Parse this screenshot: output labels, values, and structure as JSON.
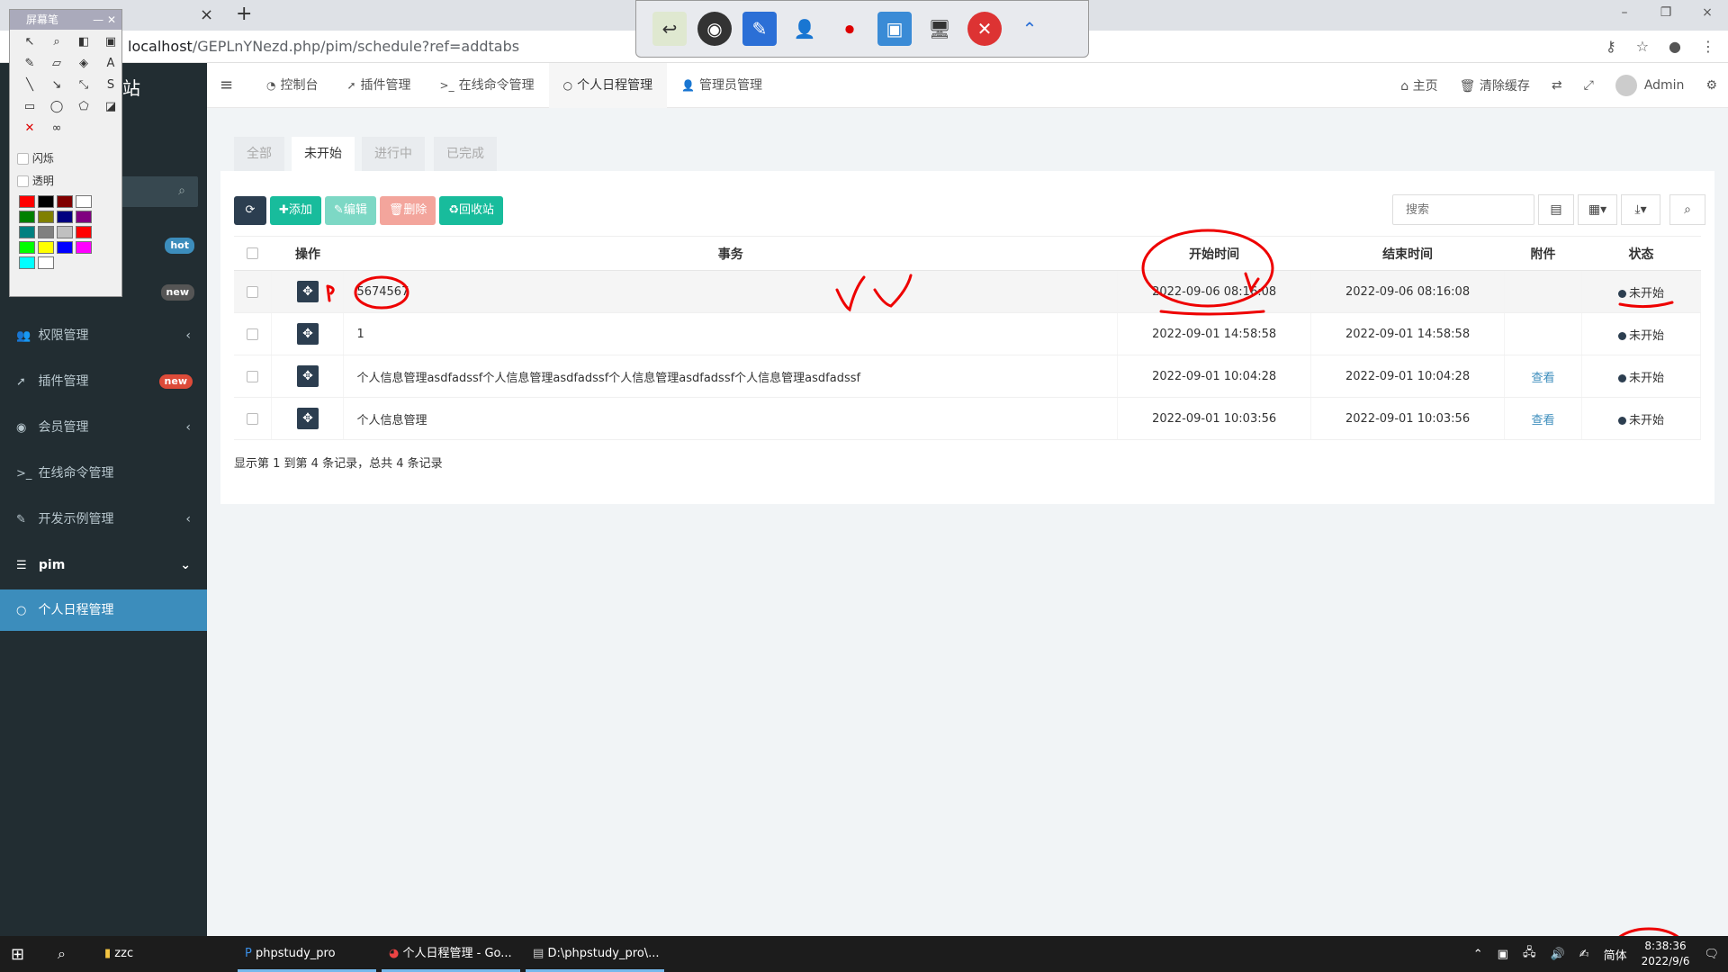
{
  "browser": {
    "close_glyph": "×",
    "new_tab_glyph": "+",
    "url_host": "localhost",
    "url_path": "/GEPLnYNezd.php/pim/schedule?ref=addtabs",
    "window_controls": [
      "–",
      "❐",
      "×"
    ]
  },
  "pen_tool": {
    "title": "屏幕笔",
    "option_flash": "闪烁",
    "option_transparent": "透明",
    "palette": [
      "#ff0000",
      "#000000",
      "#800000",
      "#ffffff",
      "#008000",
      "#808000",
      "#000080",
      "#800080",
      "#008080",
      "#808080",
      "#c0c0c0",
      "#ff0000",
      "#00ff00",
      "#ffff00",
      "#0000ff",
      "#ff00ff",
      "#00ffff",
      "#ffffff"
    ]
  },
  "sidebar": {
    "logo_suffix": "站",
    "badges": {
      "hot": "hot",
      "new": "new"
    },
    "items": [
      {
        "label": "权限管理",
        "icon": "group-icon",
        "arrow": "‹"
      },
      {
        "label": "插件管理",
        "icon": "rocket-icon",
        "badge": "new"
      },
      {
        "label": "会员管理",
        "icon": "user-circle-icon",
        "arrow": "‹"
      },
      {
        "label": "在线命令管理",
        "icon": "terminal-icon"
      },
      {
        "label": "开发示例管理",
        "icon": "magic-icon",
        "arrow": "‹"
      },
      {
        "label": "pim",
        "icon": "list-icon",
        "arrow": "⌄"
      },
      {
        "label": "个人日程管理",
        "icon": "circle-icon"
      }
    ]
  },
  "topnav": {
    "tabs": [
      {
        "label": "控制台",
        "icon": "dashboard-icon"
      },
      {
        "label": "插件管理",
        "icon": "rocket-icon"
      },
      {
        "label": "在线命令管理",
        "icon": "terminal-icon"
      },
      {
        "label": "个人日程管理",
        "icon": "circle-icon"
      },
      {
        "label": "管理员管理",
        "icon": "user-icon"
      }
    ],
    "home": "主页",
    "clear_cache": "清除缓存",
    "user": "Admin"
  },
  "subtabs": [
    "全部",
    "未开始",
    "进行中",
    "已完成"
  ],
  "toolbar": {
    "add": "添加",
    "edit": "编辑",
    "delete": "删除",
    "recycle": "回收站",
    "search_placeholder": "搜索"
  },
  "table": {
    "headers": [
      "操作",
      "事务",
      "开始时间",
      "结束时间",
      "附件",
      "状态"
    ],
    "rows": [
      {
        "task": "5674567",
        "start": "2022-09-06 08:16:08",
        "end": "2022-09-06 08:16:08",
        "attachment": "",
        "status": "未开始"
      },
      {
        "task": "1",
        "start": "2022-09-01 14:58:58",
        "end": "2022-09-01 14:58:58",
        "attachment": "",
        "status": "未开始"
      },
      {
        "task": "个人信息管理asdfadssf个人信息管理asdfadssf个人信息管理asdfadssf个人信息管理asdfadssf",
        "start": "2022-09-01 10:04:28",
        "end": "2022-09-01 10:04:28",
        "attachment": "查看",
        "status": "未开始"
      },
      {
        "task": "个人信息管理",
        "start": "2022-09-01 10:03:56",
        "end": "2022-09-01 10:03:56",
        "attachment": "查看",
        "status": "未开始"
      }
    ],
    "footer": "显示第 1 到第 4 条记录，总共 4 条记录"
  },
  "taskbar": {
    "apps": [
      "zzc",
      "phpstudy_pro",
      "个人日程管理 - Go...",
      "D:\\phpstudy_pro\\..."
    ],
    "ime": "简体",
    "time": "8:38:36",
    "date": "2022/9/6"
  }
}
